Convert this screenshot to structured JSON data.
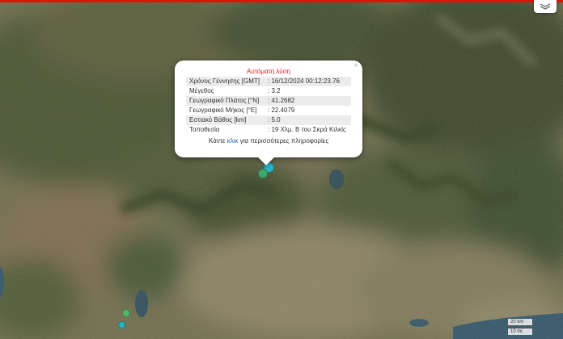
{
  "popup": {
    "title": "Αυτόματη λύση",
    "close_symbol": "×",
    "rows": [
      {
        "label": "Χρόνος Γέννησης [GMT]",
        "value": ": 16/12/2024 00:12:23.76"
      },
      {
        "label": "Μέγεθος",
        "value": ": 3.2"
      },
      {
        "label": "Γεωγραφικό Πλάτος [°N]",
        "value": ": 41.2682"
      },
      {
        "label": "Γεωγραφικό Μήκος [°E]",
        "value": ": 22.4079"
      },
      {
        "label": "Εστιακό Βάθος [km]",
        "value": ": 5.0"
      },
      {
        "label": "Τοποθεσία",
        "value": ": 19 Χλμ. Β του Σκρά Κιλκίς"
      }
    ],
    "more_prefix": "Κάντε ",
    "more_link": "κλικ",
    "more_suffix": " για περισσότερες πληροφορίες"
  },
  "scale": {
    "km_label": "20 km",
    "mi_label": "10 mi"
  },
  "colors": {
    "accent_bar": "#d4190b",
    "popup_title": "#d21f1f",
    "link": "#1a63b7",
    "marker_selected": "#27b5c4",
    "marker_green": "#3fa96b"
  },
  "icons": [
    "layers-icon",
    "close-icon"
  ]
}
